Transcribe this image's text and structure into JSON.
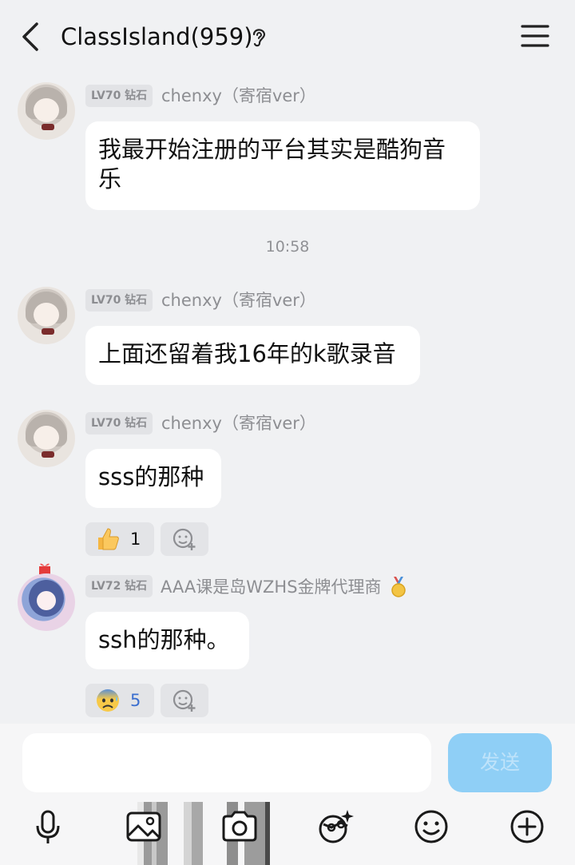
{
  "header": {
    "title": "ClassIsland(959)"
  },
  "messages": [
    {
      "level": "LV70 钻石",
      "name": "chenxy（寄宿ver）",
      "text": "我最开始注册的平台其实是酷狗音乐"
    },
    {
      "time": "10:58"
    },
    {
      "level": "LV70 钻石",
      "name": "chenxy（寄宿ver）",
      "text": "上面还留着我16年的k歌录音"
    },
    {
      "level": "LV70 钻石",
      "name": "chenxy（寄宿ver）",
      "text": "sss的那种",
      "reaction": {
        "icon": "thumbs-up-icon",
        "count": "1"
      }
    },
    {
      "level": "LV72 钻石",
      "name": "AAA课是岛WZHS金牌代理商",
      "text": "ssh的那种。",
      "reaction": {
        "icon": "anxious-face-icon",
        "count": "5"
      }
    }
  ],
  "composer": {
    "placeholder": "",
    "send_label": "发送"
  },
  "toolbar": [
    "microphone-icon",
    "image-icon",
    "camera-icon",
    "sticker-icon",
    "emoji-icon",
    "plus-icon"
  ],
  "colors": {
    "background": "#f0f1f3",
    "bubble": "#ffffff",
    "send_button": "#8fcff6",
    "badge": "#e2e3e6"
  }
}
